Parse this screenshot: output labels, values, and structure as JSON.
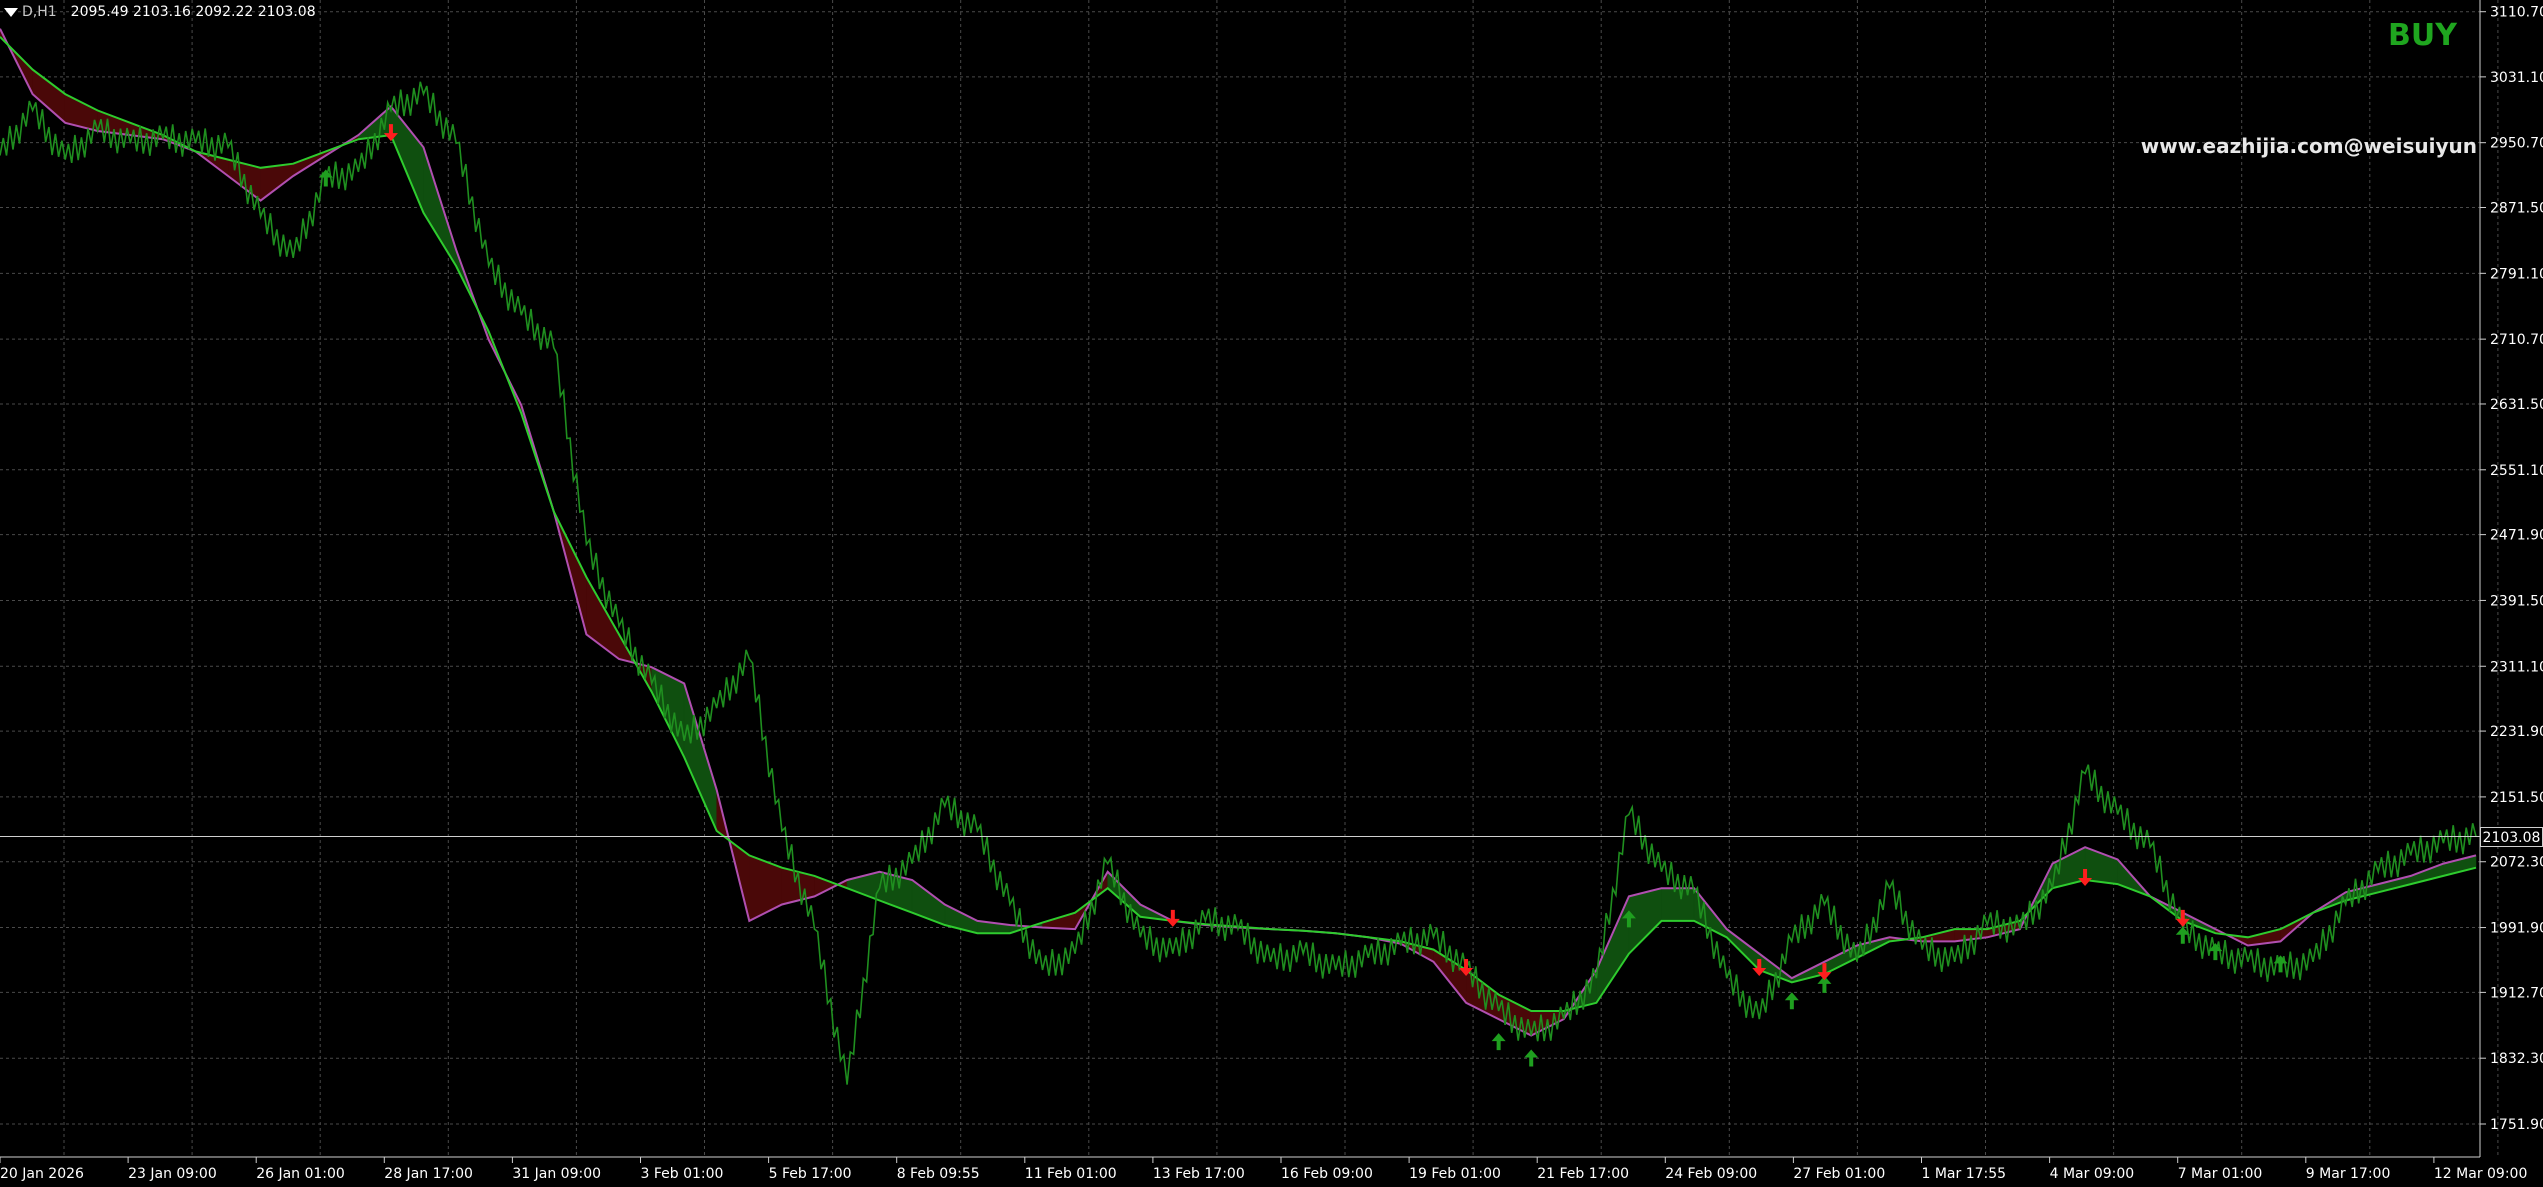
{
  "header": {
    "symbol": "D,H1",
    "ohlc": "2095.49 2103.16 2092.22 2103.08"
  },
  "signal_label": "BUY",
  "watermark": "www.eazhijia.com@weisuiyun",
  "current_price_tag": "2103.08",
  "colors": {
    "background": "#000000",
    "grid": "#4a4a4a",
    "price": "#1f8f1f",
    "bull_cloud": "#0f4f0f",
    "bear_cloud": "#4a0808",
    "fast_line": "#2ecc2e",
    "slow_line": "#b04fb0",
    "buy_arrow": "#1f9f1f",
    "sell_arrow": "#ff1e1e",
    "axis_text": "#ffffff"
  },
  "chart_data": {
    "type": "line",
    "title": "",
    "timeframe": "H1",
    "ylim": [
      1711.6,
      3125.0
    ],
    "y_ticks": [
      "3110.70",
      "3031.10",
      "2950.70",
      "2871.50",
      "2791.10",
      "2710.70",
      "2631.50",
      "2551.10",
      "2471.90",
      "2391.50",
      "2311.10",
      "2231.90",
      "2151.50",
      "2072.30",
      "1991.90",
      "1912.70",
      "1832.30",
      "1751.90"
    ],
    "x_ticks": [
      "20 Jan 2026",
      "23 Jan 09:00",
      "26 Jan 01:00",
      "28 Jan 17:00",
      "31 Jan 09:00",
      "3 Feb 01:00",
      "5 Feb 17:00",
      "8 Feb 09:55",
      "11 Feb 01:00",
      "13 Feb 17:00",
      "16 Feb 09:00",
      "19 Feb 01:00",
      "21 Feb 17:00",
      "24 Feb 09:00",
      "27 Feb 01:00",
      "1 Mar 17:55",
      "4 Mar 09:00",
      "7 Mar 01:00",
      "9 Mar 17:00",
      "12 Mar 09:00"
    ],
    "x": [
      0,
      1,
      2,
      3,
      4,
      5,
      6,
      7,
      8,
      9,
      10,
      11,
      12,
      13,
      14,
      15,
      16,
      17,
      18,
      19,
      20,
      21,
      22,
      23,
      24,
      25,
      26,
      27,
      28,
      29,
      30,
      31,
      32,
      33,
      34,
      35,
      36,
      37,
      38,
      39,
      40,
      41,
      42,
      43,
      44,
      45,
      46,
      47,
      48,
      49,
      50,
      51,
      52,
      53,
      54,
      55,
      56,
      57,
      58,
      59,
      60,
      61,
      62,
      63,
      64,
      65,
      66,
      67,
      68,
      69,
      70,
      71,
      72,
      73,
      74,
      75,
      76
    ],
    "series": [
      {
        "name": "",
        "role": "close",
        "values": [
          2935,
          2990,
          2930,
          2965,
          2950,
          2955,
          2950,
          2945,
          2860,
          2810,
          2905,
          2915,
          2990,
          3010,
          2950,
          2800,
          2740,
          2700,
          2460,
          2360,
          2290,
          2220,
          2260,
          2320,
          2110,
          1990,
          1800,
          2040,
          2070,
          2140,
          2110,
          2020,
          1940,
          1960,
          2070,
          1980,
          1960,
          2000,
          1990,
          1950,
          1960,
          1940,
          1955,
          1970,
          1980,
          1940,
          1890,
          1860,
          1880,
          1930,
          2130,
          2060,
          2035,
          1930,
          1880,
          1975,
          2020,
          1950,
          2040,
          1965,
          1950,
          1995,
          1990,
          2040,
          2180,
          2130,
          2090,
          1990,
          1960,
          1950,
          1940,
          1950,
          2020,
          2060,
          2080,
          2095,
          2103
        ]
      },
      {
        "name": "",
        "role": "fast",
        "values": [
          3080,
          3040,
          3010,
          2990,
          2975,
          2960,
          2940,
          2930,
          2920,
          2925,
          2940,
          2955,
          2960,
          2865,
          2800,
          2720,
          2620,
          2500,
          2420,
          2350,
          2280,
          2200,
          2110,
          2080,
          2065,
          2055,
          2040,
          2025,
          2010,
          1995,
          1985,
          1985,
          1998,
          2010,
          2040,
          2005,
          2000,
          1996,
          1993,
          1990,
          1988,
          1985,
          1980,
          1975,
          1965,
          1940,
          1910,
          1890,
          1890,
          1900,
          1960,
          2000,
          2000,
          1980,
          1940,
          1925,
          1935,
          1955,
          1975,
          1980,
          1990,
          1990,
          2000,
          2040,
          2050,
          2045,
          2030,
          2000,
          1985,
          1980,
          1990,
          2010,
          2025,
          2035,
          2045,
          2055,
          2065
        ]
      },
      {
        "name": "",
        "role": "slow",
        "values": [
          3090,
          3010,
          2975,
          2965,
          2960,
          2955,
          2940,
          2910,
          2880,
          2910,
          2935,
          2960,
          2995,
          2945,
          2820,
          2710,
          2630,
          2500,
          2350,
          2320,
          2310,
          2290,
          2160,
          2000,
          2020,
          2030,
          2050,
          2060,
          2050,
          2020,
          2000,
          1995,
          1992,
          1990,
          2060,
          2020,
          2000,
          1995,
          1992,
          1990,
          1988,
          1985,
          1980,
          1972,
          1950,
          1900,
          1880,
          1860,
          1880,
          1940,
          2030,
          2040,
          2040,
          1990,
          1960,
          1930,
          1950,
          1970,
          1980,
          1975,
          1975,
          1980,
          1990,
          2070,
          2090,
          2075,
          2030,
          2010,
          1990,
          1970,
          1975,
          2010,
          2035,
          2045,
          2055,
          2070,
          2080
        ]
      }
    ],
    "buy_arrows_at_x": [
      10,
      46,
      47,
      50,
      55,
      56,
      67,
      68,
      70
    ],
    "sell_arrows_at_x": [
      12,
      36,
      45,
      54,
      56,
      64,
      67
    ],
    "grid": true,
    "legend": "none"
  }
}
